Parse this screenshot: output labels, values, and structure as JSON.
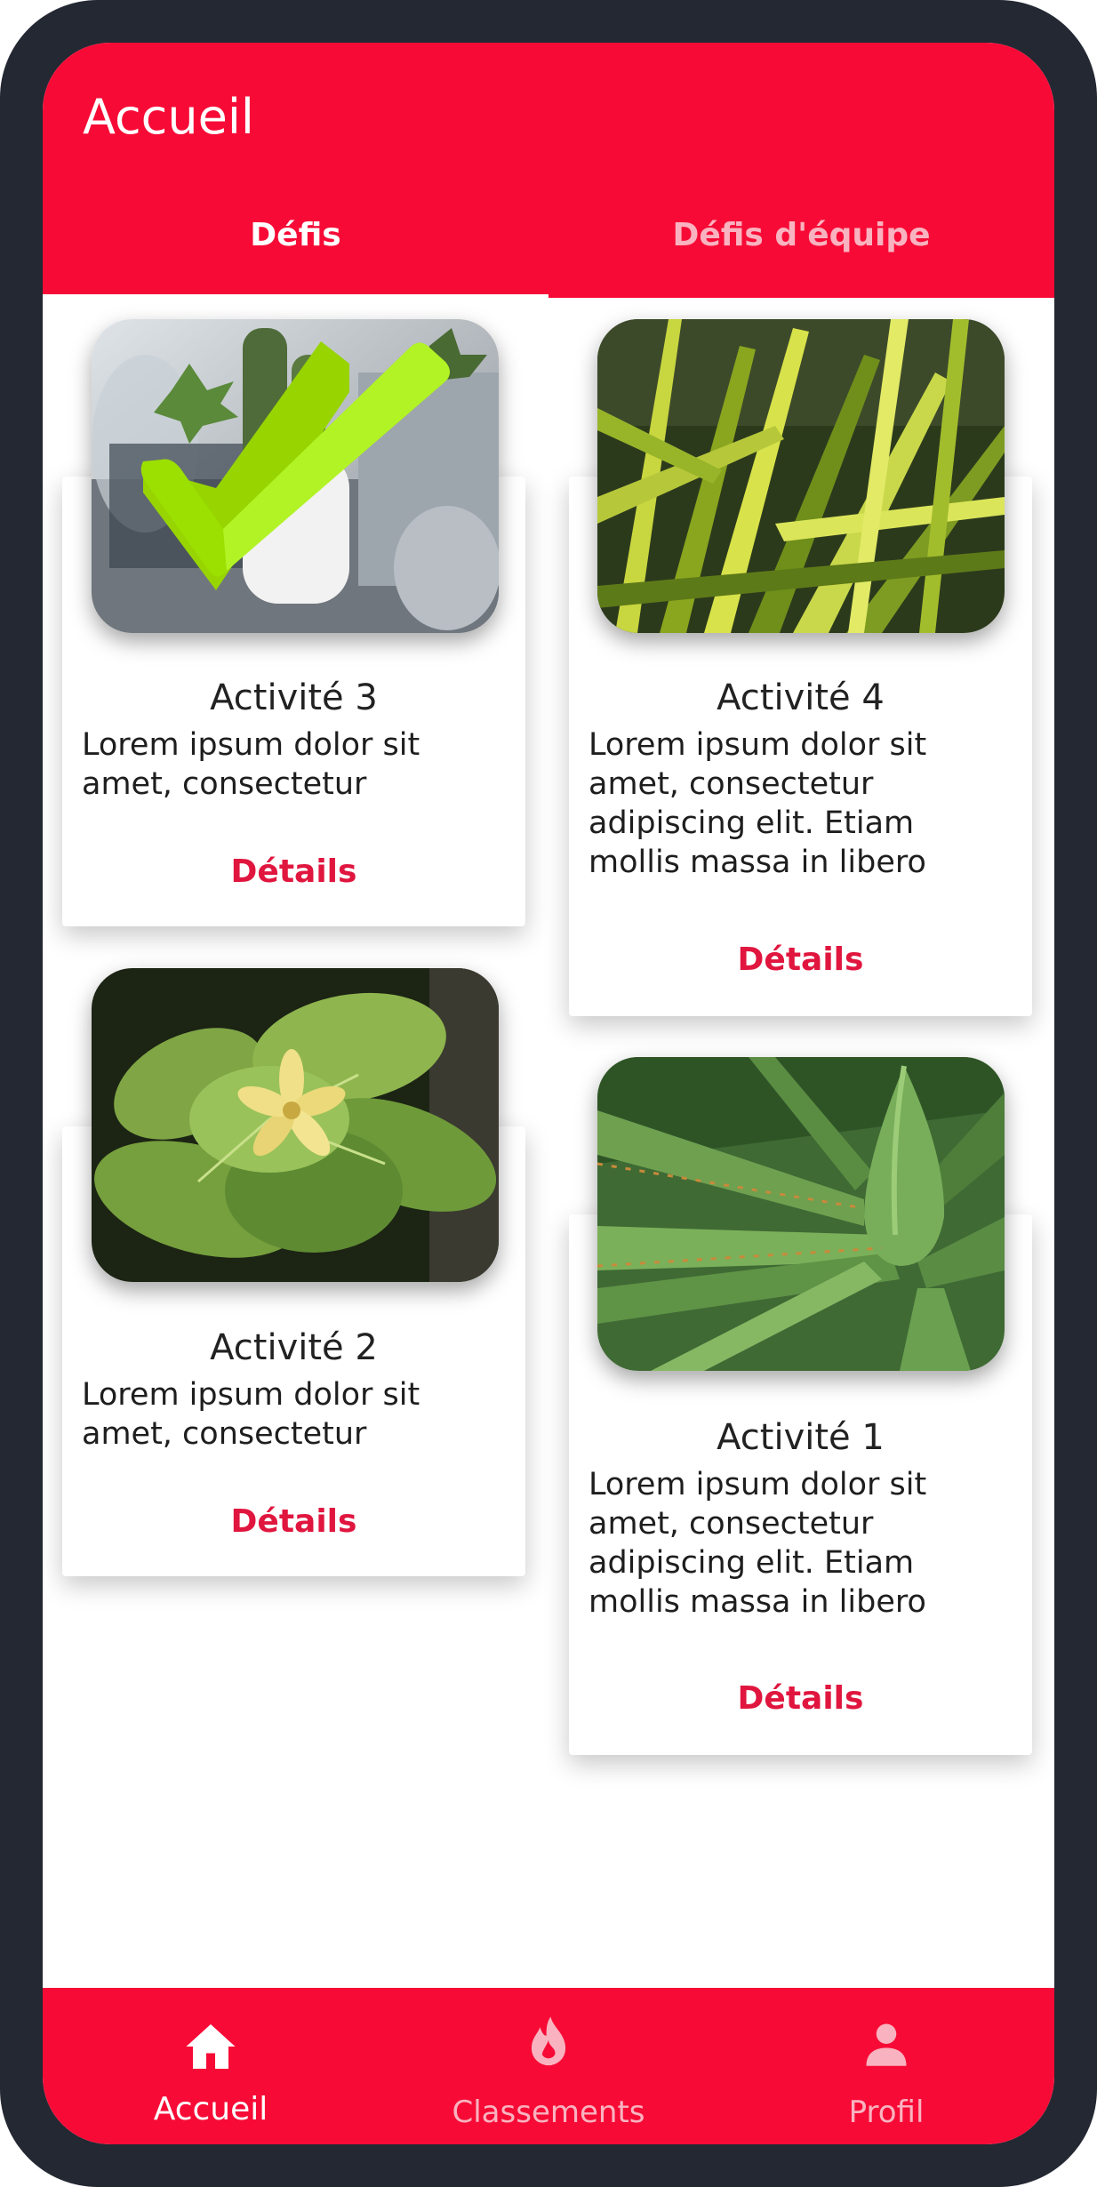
{
  "app": {
    "title": "Accueil"
  },
  "tabs": [
    {
      "label": "Défis",
      "active": true
    },
    {
      "label": "Défis d'équipe",
      "active": false
    }
  ],
  "cards": [
    {
      "title": "Activité 3",
      "text": "Lorem ipsum dolor sit amet, consectetur",
      "link": "Détails",
      "image": "cactus-with-checkmark-photo",
      "completed": true
    },
    {
      "title": "Activité 4",
      "text": "Lorem ipsum dolor sit amet, consectetur adipiscing elit. Etiam mollis massa in libero venenatis mattis. Etiam ut nibh",
      "link": "Détails",
      "image": "variegated-leaves-photo",
      "completed": false
    },
    {
      "title": "Activité 2",
      "text": "Lorem ipsum dolor sit amet, consectetur",
      "link": "Détails",
      "image": "leafy-plant-with-flower-photo",
      "completed": false
    },
    {
      "title": "Activité 1",
      "text": "Lorem ipsum dolor sit amet, consectetur adipiscing elit. Etiam mollis massa in libero venenatis mattis. Etiam ut nibh",
      "link": "Détails",
      "image": "agave-photo",
      "completed": false
    }
  ],
  "bottom_nav": [
    {
      "label": "Accueil",
      "icon": "home-icon",
      "active": true
    },
    {
      "label": "Classements",
      "icon": "fire-icon",
      "active": false
    },
    {
      "label": "Profil",
      "icon": "person-icon",
      "active": false
    }
  ],
  "colors": {
    "brand": "#f70b36",
    "link": "#e0163f",
    "frame": "#232833",
    "check": "#9be000"
  }
}
